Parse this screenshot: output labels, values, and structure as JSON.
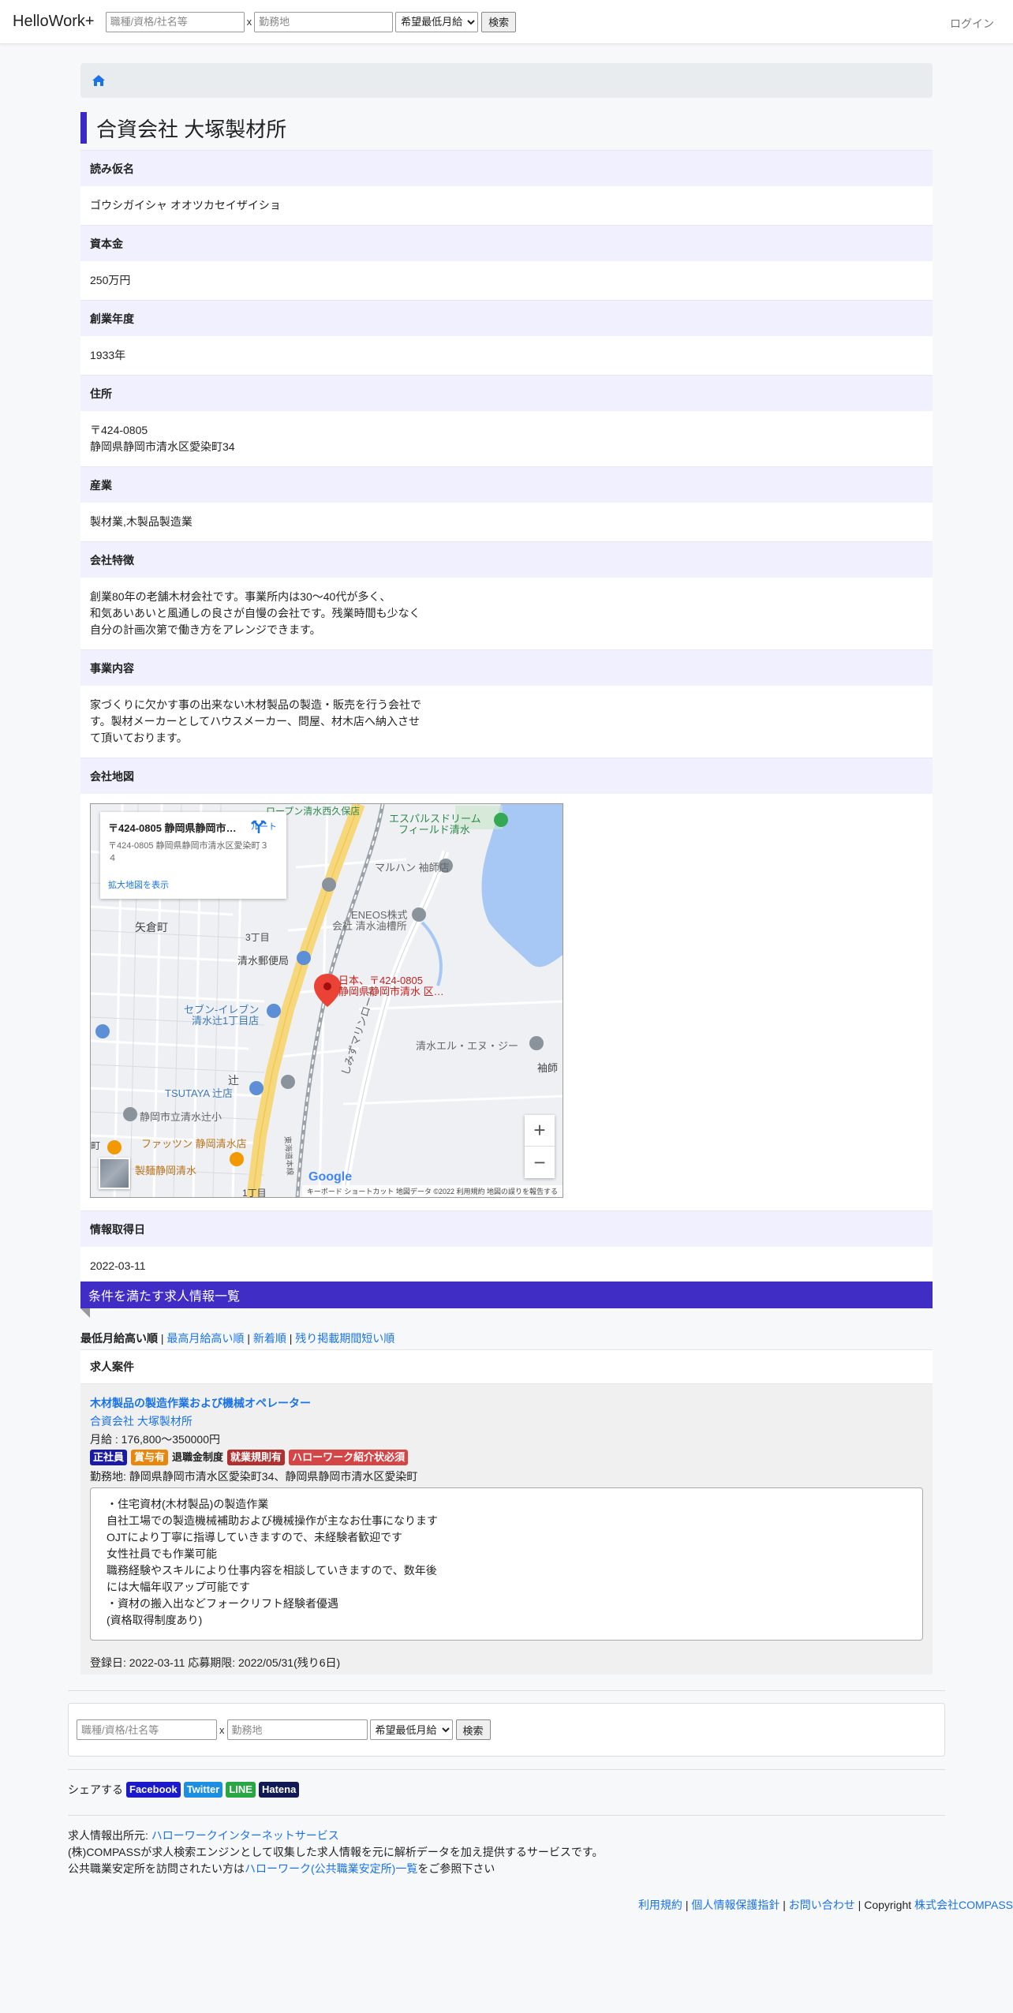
{
  "header": {
    "brand": "HelloWork+",
    "search_job_placeholder": "職種/資格/社名等",
    "x": "x",
    "search_loc_placeholder": "勤務地",
    "select_value": "希望最低月給",
    "search_button": "検索",
    "login": "ログイン"
  },
  "company": {
    "name": "合資会社 大塚製材所",
    "fields": [
      {
        "label": "読み仮名",
        "value": "ゴウシガイシャ オオツカセイザイショ"
      },
      {
        "label": "資本金",
        "value": "250万円"
      },
      {
        "label": "創業年度",
        "value": "1933年"
      },
      {
        "label": "住所",
        "value": "〒424-0805\n静岡県静岡市清水区愛染町34"
      },
      {
        "label": "産業",
        "value": "製材業,木製品製造業"
      },
      {
        "label": "会社特徴",
        "value": "創業80年の老舗木材会社です。事業所内は30～40代が多く、\n和気あいあいと風通しの良さが自慢の会社です。残業時間も少なく\n自分の計画次第で働き方をアレンジできます。"
      },
      {
        "label": "事業内容",
        "value": "家づくりに欠かす事の出来ない木材製品の製造・販売を行う会社で\nす。製材メーカーとしてハウスメーカー、問屋、材木店へ納入させ\nて頂いております。"
      }
    ],
    "map_label": "会社地図",
    "date_label": "情報取得日",
    "date_value": "2022-03-11"
  },
  "map": {
    "info_title": "〒424-0805 静岡県静岡市清水...",
    "info_addr": "〒424-0805 静岡県静岡市清水区愛染町３４",
    "info_link": "拡大地図を表示",
    "route": "ルート",
    "pin_label_1": "日本、〒424-0805",
    "pin_label_2": "静岡県静岡市清水 区…",
    "labels": {
      "l1": "エスパルスドリーム",
      "l2": "フィールド清水",
      "l3": "マルハン 袖師店",
      "l4": "ENEOS株式",
      "l5": "会社 清水油槽所",
      "l6": "矢倉町",
      "l7": "3丁目",
      "l8": "清水郵便局",
      "l9": "セブン-イレブン",
      "l10": "清水辻1丁目店",
      "l11": "清水エル・エヌ・ジー",
      "l12": "袖師",
      "l13": "辻",
      "l14": "TSUTAYA 辻店",
      "l15": "静岡市立清水辻小",
      "l16": "ファッツン 静岡清水店",
      "l17": "製麺静岡清水",
      "l18": "しみずマリンロード",
      "l19": "東海道本線",
      "l20": "1丁目",
      "l21": "町",
      "l22": "ロープン清水西久保店"
    },
    "zoom_in": "+",
    "zoom_out": "−",
    "google": "Google",
    "attribution": "キーボード ショートカット   地図データ ©2022   利用規約   地図の誤りを報告する"
  },
  "jobs": {
    "section_title": "条件を満たす求人情報一覧",
    "sort_active": "最低月給高い順",
    "sort_options": [
      "最高月給高い順",
      "新着順",
      "残り掲載期間短い順"
    ],
    "sep": "|",
    "list_header": "求人案件",
    "items": [
      {
        "title": "木材製品の製造作業および機械オペレーター",
        "company": "合資会社 大塚製材所",
        "salary": "月給 : 176,800〜350000円",
        "badges": [
          {
            "text": "正社員",
            "color": "#1a1aa6"
          },
          {
            "text": "賞与有",
            "color": "#e8870c"
          },
          {
            "text": "退職金制度",
            "color": ""
          },
          {
            "text": "就業規則有",
            "color": "#b03030"
          },
          {
            "text": "ハローワーク紹介状必須",
            "color": "#d64545"
          }
        ],
        "location": "勤務地: 静岡県静岡市清水区愛染町34、静岡県静岡市清水区愛染町",
        "description": "・住宅資材(木材製品)の製造作業\n自社工場での製造機械補助および機械操作が主なお仕事になります\nOJTにより丁寧に指導していきますので、未経験者歓迎です\n女性社員でも作業可能\n職務経験やスキルにより仕事内容を相談していきますので、数年後\nには大幅年収アップ可能です\n・資材の搬入出などフォークリフト経験者優遇\n(資格取得制度あり)",
        "dates": "登録日: 2022-03-11 応募期限: 2022/05/31(残り6日)"
      }
    ]
  },
  "share": {
    "label": "シェアする",
    "buttons": [
      {
        "text": "Facebook",
        "color": "#1a1acc"
      },
      {
        "text": "Twitter",
        "color": "#1d8fe0"
      },
      {
        "text": "LINE",
        "color": "#2aa745"
      },
      {
        "text": "Hatena",
        "color": "#111a55"
      }
    ]
  },
  "footer": {
    "source_label": "求人情報出所元: ",
    "source_link": "ハローワークインターネットサービス",
    "line2": "(株)COMPASSが求人検索エンジンとして収集した求人情報を元に解析データを加え提供するサービスです。",
    "line3_pre": "公共職業安定所を訪問されたい方は",
    "line3_link": "ハローワーク(公共職業安定所)一覧",
    "line3_post": "をご参照下さい",
    "links": [
      "利用規約",
      "個人情報保護指針",
      "お問い合わせ"
    ],
    "copyright": "Copyright",
    "company_link": "株式会社COMPASS"
  },
  "colors": {
    "accent": "#3f2dc6",
    "label_bg": "#f0f0ff",
    "link": "#1a73e8"
  }
}
